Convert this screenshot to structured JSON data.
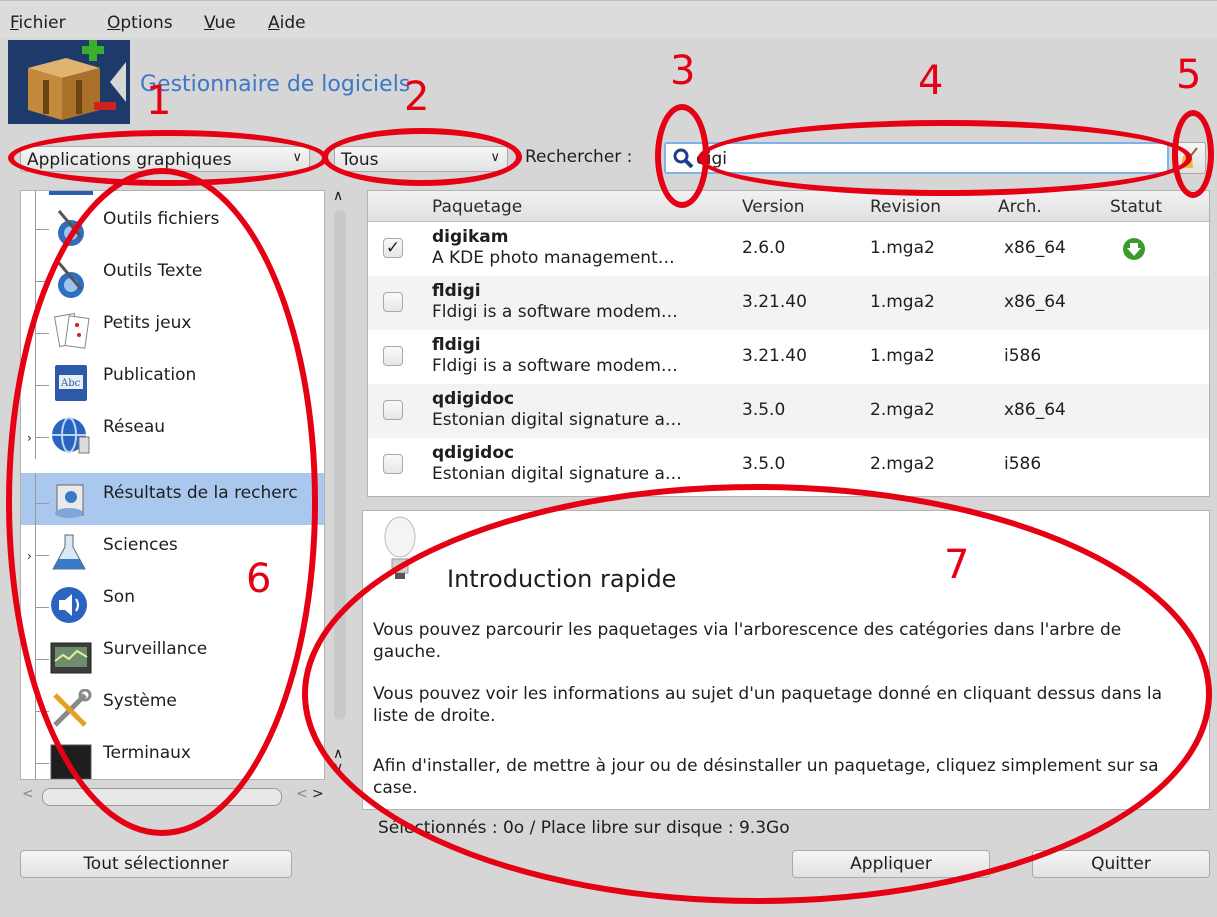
{
  "menu": [
    "Fichier",
    "Options",
    "Vue",
    "Aide"
  ],
  "header": {
    "title": "Gestionnaire de logiciels"
  },
  "filters": {
    "category_filter": "Applications graphiques",
    "status_filter": "Tous",
    "search_label": "Rechercher :",
    "search_value": "digi"
  },
  "categories": [
    {
      "label": "Outils fichiers",
      "icon": "file-tools-icon"
    },
    {
      "label": "Outils Texte",
      "icon": "text-tools-icon"
    },
    {
      "label": "Petits jeux",
      "icon": "cards-icon"
    },
    {
      "label": "Publication",
      "icon": "book-icon"
    },
    {
      "label": "Réseau",
      "icon": "globe-icon"
    },
    {
      "label": "Résultats de la recherc",
      "icon": "search-results-icon",
      "selected": true
    },
    {
      "label": "Sciences",
      "icon": "flask-icon"
    },
    {
      "label": "Son",
      "icon": "speaker-icon"
    },
    {
      "label": "Surveillance",
      "icon": "monitor-icon"
    },
    {
      "label": "Système",
      "icon": "tools-icon"
    },
    {
      "label": "Terminaux",
      "icon": "terminal-icon"
    }
  ],
  "table": {
    "columns": [
      "Paquetage",
      "Version",
      "Revision",
      "Arch.",
      "Statut"
    ],
    "rows": [
      {
        "name": "digikam",
        "desc": "A KDE photo management…",
        "version": "2.6.0",
        "revision": "1.mga2",
        "arch": "x86_64",
        "checked": "✓",
        "status_icon": "install-icon"
      },
      {
        "name": "fldigi",
        "desc": "Fldigi is a software modem…",
        "version": "3.21.40",
        "revision": "1.mga2",
        "arch": "x86_64",
        "checked": ""
      },
      {
        "name": "fldigi",
        "desc": "Fldigi is a software modem…",
        "version": "3.21.40",
        "revision": "1.mga2",
        "arch": "i586",
        "checked": ""
      },
      {
        "name": "qdigidoc",
        "desc": "Estonian digital signature a…",
        "version": "3.5.0",
        "revision": "2.mga2",
        "arch": "x86_64",
        "checked": ""
      },
      {
        "name": "qdigidoc",
        "desc": "Estonian digital signature a…",
        "version": "3.5.0",
        "revision": "2.mga2",
        "arch": "i586",
        "checked": ""
      }
    ]
  },
  "info": {
    "title": "Introduction rapide",
    "p1": "Vous pouvez parcourir les paquetages via l'arborescence des catégories dans l'arbre de gauche.",
    "p2": "Vous pouvez voir les informations au sujet d'un paquetage donné en cliquant dessus dans la liste de droite.",
    "p3": "Afin d'installer, de mettre à jour ou de désinstaller un paquetage, cliquez simplement sur sa case."
  },
  "status": "Sélectionnés : 0o / Place libre sur disque : 9.3Go",
  "buttons": {
    "select_all": "Tout sélectionner",
    "apply": "Appliquer",
    "quit": "Quitter"
  },
  "annotations": [
    "1",
    "2",
    "3",
    "4",
    "5",
    "6",
    "7"
  ],
  "colors": {
    "annotation": "#e60014",
    "title": "#3d78c8",
    "selection": "#aac8ee"
  }
}
